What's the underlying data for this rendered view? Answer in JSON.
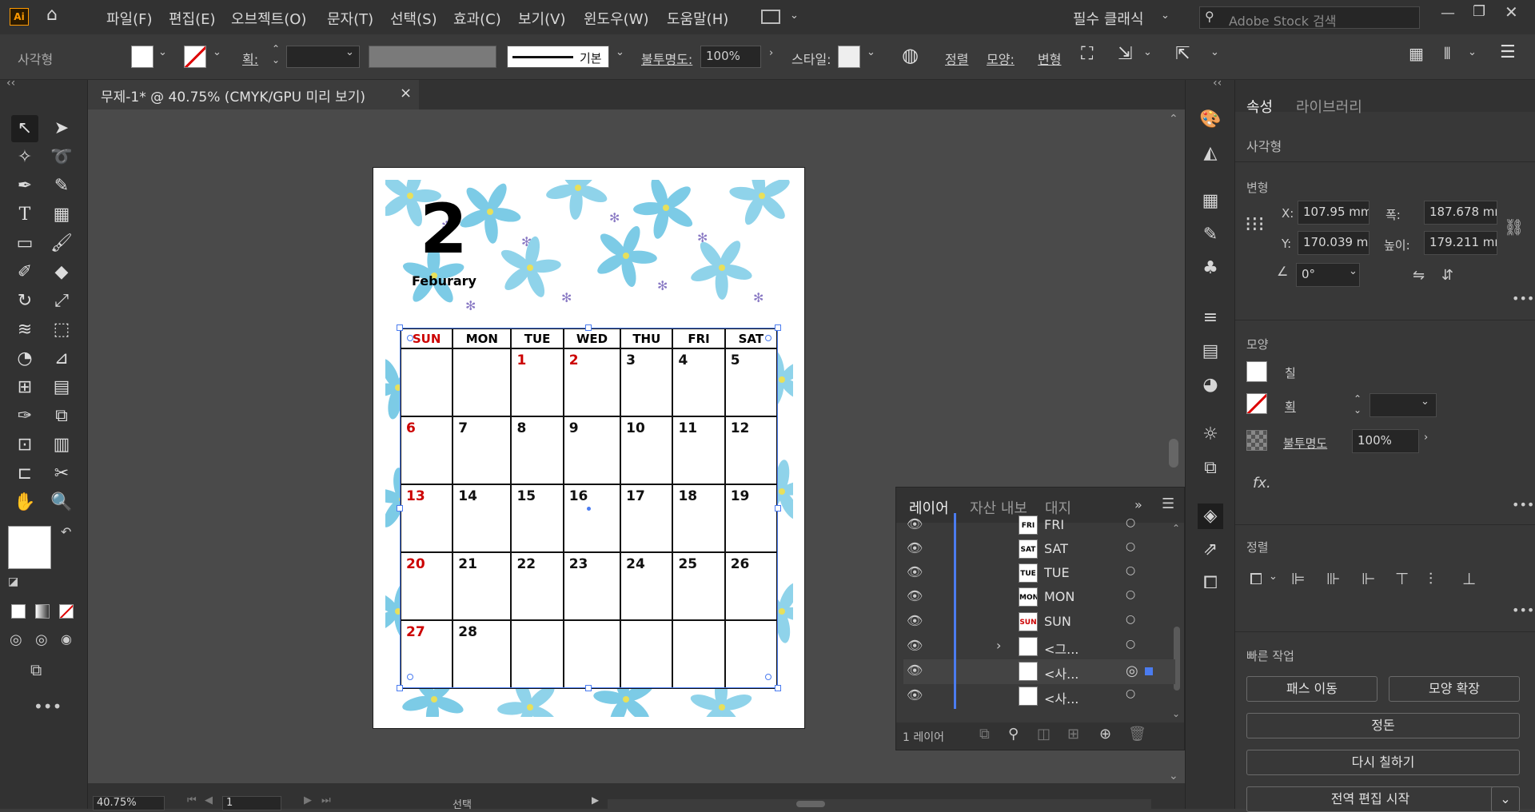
{
  "menubar": {
    "items": [
      "파일(F)",
      "편집(E)",
      "오브젝트(O)",
      "문자(T)",
      "선택(S)",
      "효과(C)",
      "보기(V)",
      "윈도우(W)",
      "도움말(H)"
    ],
    "workspace": "필수 클래식",
    "search_placeholder": "Adobe Stock 검색"
  },
  "control": {
    "object_type": "사각형",
    "stroke_label": "획:",
    "brush_label": "기본",
    "opacity_label": "불투명도:",
    "opacity_value": "100%",
    "style_label": "스타일:",
    "align_label": "정렬",
    "shape_label": "모양:",
    "transform_label": "변형"
  },
  "document": {
    "tab_title": "무제-1* @ 40.75% (CMYK/GPU 미리 보기)",
    "close": "×"
  },
  "calendar": {
    "month_number": "2",
    "month_name": "Feburary",
    "days": [
      "SUN",
      "MON",
      "TUE",
      "WED",
      "THU",
      "FRI",
      "SAT"
    ],
    "weeks": [
      [
        "",
        "",
        "1",
        "2",
        "3",
        "4",
        "5"
      ],
      [
        "6",
        "7",
        "8",
        "9",
        "10",
        "11",
        "12"
      ],
      [
        "13",
        "14",
        "15",
        "16",
        "17",
        "18",
        "19"
      ],
      [
        "20",
        "21",
        "22",
        "23",
        "24",
        "25",
        "26"
      ],
      [
        "27",
        "28",
        "",
        "",
        "",
        "",
        ""
      ]
    ],
    "red_color": "#cc0000"
  },
  "layers_panel": {
    "tabs": [
      "레이어",
      "자산 내보",
      "대지"
    ],
    "rows": [
      {
        "thumb": "FRI",
        "name": "FRI"
      },
      {
        "thumb": "SAT",
        "name": "SAT"
      },
      {
        "thumb": "TUE",
        "name": "TUE"
      },
      {
        "thumb": "MON",
        "name": "MON"
      },
      {
        "thumb": "SUN",
        "name": "SUN"
      },
      {
        "thumb": "",
        "name": "<그..."
      },
      {
        "thumb": "",
        "name": "<사..."
      },
      {
        "thumb": "",
        "name": "<사..."
      }
    ],
    "footer": "1 레이어"
  },
  "properties": {
    "tabs": [
      "속성",
      "라이브러리"
    ],
    "object_type": "사각형",
    "transform_header": "변형",
    "x_label": "X:",
    "x_value": "107.95 mm",
    "y_label": "Y:",
    "y_value": "170.039 mr",
    "w_label": "폭:",
    "w_value": "187.678 mr",
    "h_label": "높이:",
    "h_value": "179.211 mr",
    "angle_value": "0°",
    "appearance_header": "모양",
    "fill_label": "칠",
    "stroke_label": "획",
    "opacity_label": "불투명도",
    "opacity_value": "100%",
    "fx_label": "fx.",
    "align_header": "정렬",
    "quick_header": "빠른 작업",
    "btn_path_move": "패스 이동",
    "btn_shape_expand": "모양 확장",
    "btn_arrange": "정돈",
    "btn_recolor": "다시 칠하기",
    "btn_global_edit": "전역 편집 시작"
  },
  "status": {
    "zoom": "40.75%",
    "artboard": "1",
    "mode": "선택"
  }
}
